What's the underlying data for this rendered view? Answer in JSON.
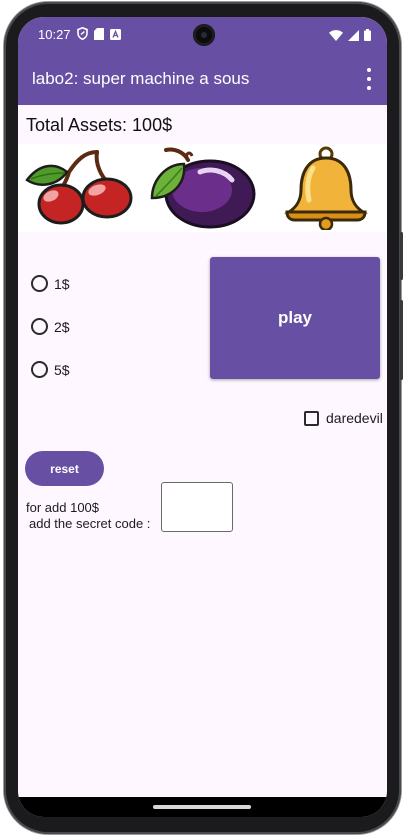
{
  "status_bar": {
    "time": "10:27",
    "left_icons": [
      "shield-icon",
      "sd-card-icon",
      "text-notification-icon"
    ],
    "right_icons": [
      "wifi-icon",
      "signal-icon",
      "battery-icon"
    ]
  },
  "app_bar": {
    "title": "labo2: super machine a sous",
    "background": "#6750a4",
    "overflow_icon": "more-vert-icon"
  },
  "assets": {
    "text": "Total Assets: 100$"
  },
  "reels": [
    {
      "symbol": "cherries-icon"
    },
    {
      "symbol": "plum-icon"
    },
    {
      "symbol": "bell-icon"
    }
  ],
  "bets": {
    "options": [
      {
        "label": "1$",
        "selected": false
      },
      {
        "label": "2$",
        "selected": false
      },
      {
        "label": "5$",
        "selected": false
      }
    ]
  },
  "play_button": {
    "label": "play",
    "color": "#6750a4"
  },
  "daredevil": {
    "label": "daredevil",
    "checked": false
  },
  "reset_button": {
    "label": "reset"
  },
  "secret": {
    "line1": "for add 100$",
    "line2": "add the secret code :",
    "value": ""
  }
}
